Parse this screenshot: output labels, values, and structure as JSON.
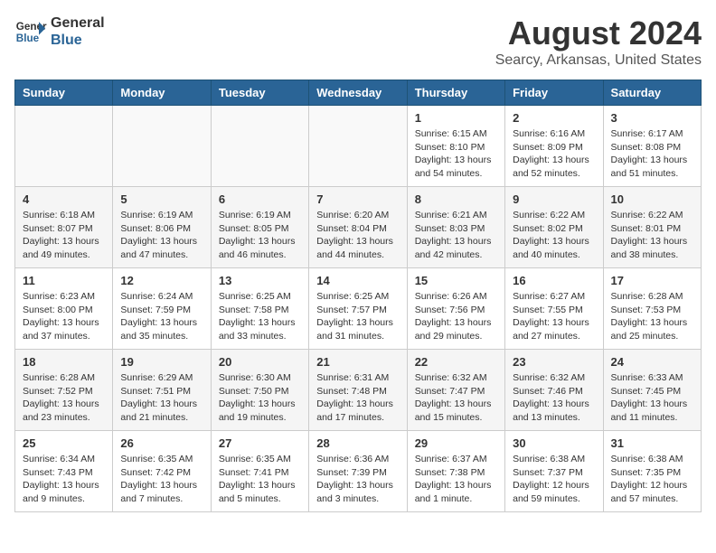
{
  "header": {
    "logo_line1": "General",
    "logo_line2": "Blue",
    "title": "August 2024",
    "subtitle": "Searcy, Arkansas, United States"
  },
  "weekdays": [
    "Sunday",
    "Monday",
    "Tuesday",
    "Wednesday",
    "Thursday",
    "Friday",
    "Saturday"
  ],
  "weeks": [
    [
      {
        "day": "",
        "info": ""
      },
      {
        "day": "",
        "info": ""
      },
      {
        "day": "",
        "info": ""
      },
      {
        "day": "",
        "info": ""
      },
      {
        "day": "1",
        "info": "Sunrise: 6:15 AM\nSunset: 8:10 PM\nDaylight: 13 hours\nand 54 minutes."
      },
      {
        "day": "2",
        "info": "Sunrise: 6:16 AM\nSunset: 8:09 PM\nDaylight: 13 hours\nand 52 minutes."
      },
      {
        "day": "3",
        "info": "Sunrise: 6:17 AM\nSunset: 8:08 PM\nDaylight: 13 hours\nand 51 minutes."
      }
    ],
    [
      {
        "day": "4",
        "info": "Sunrise: 6:18 AM\nSunset: 8:07 PM\nDaylight: 13 hours\nand 49 minutes."
      },
      {
        "day": "5",
        "info": "Sunrise: 6:19 AM\nSunset: 8:06 PM\nDaylight: 13 hours\nand 47 minutes."
      },
      {
        "day": "6",
        "info": "Sunrise: 6:19 AM\nSunset: 8:05 PM\nDaylight: 13 hours\nand 46 minutes."
      },
      {
        "day": "7",
        "info": "Sunrise: 6:20 AM\nSunset: 8:04 PM\nDaylight: 13 hours\nand 44 minutes."
      },
      {
        "day": "8",
        "info": "Sunrise: 6:21 AM\nSunset: 8:03 PM\nDaylight: 13 hours\nand 42 minutes."
      },
      {
        "day": "9",
        "info": "Sunrise: 6:22 AM\nSunset: 8:02 PM\nDaylight: 13 hours\nand 40 minutes."
      },
      {
        "day": "10",
        "info": "Sunrise: 6:22 AM\nSunset: 8:01 PM\nDaylight: 13 hours\nand 38 minutes."
      }
    ],
    [
      {
        "day": "11",
        "info": "Sunrise: 6:23 AM\nSunset: 8:00 PM\nDaylight: 13 hours\nand 37 minutes."
      },
      {
        "day": "12",
        "info": "Sunrise: 6:24 AM\nSunset: 7:59 PM\nDaylight: 13 hours\nand 35 minutes."
      },
      {
        "day": "13",
        "info": "Sunrise: 6:25 AM\nSunset: 7:58 PM\nDaylight: 13 hours\nand 33 minutes."
      },
      {
        "day": "14",
        "info": "Sunrise: 6:25 AM\nSunset: 7:57 PM\nDaylight: 13 hours\nand 31 minutes."
      },
      {
        "day": "15",
        "info": "Sunrise: 6:26 AM\nSunset: 7:56 PM\nDaylight: 13 hours\nand 29 minutes."
      },
      {
        "day": "16",
        "info": "Sunrise: 6:27 AM\nSunset: 7:55 PM\nDaylight: 13 hours\nand 27 minutes."
      },
      {
        "day": "17",
        "info": "Sunrise: 6:28 AM\nSunset: 7:53 PM\nDaylight: 13 hours\nand 25 minutes."
      }
    ],
    [
      {
        "day": "18",
        "info": "Sunrise: 6:28 AM\nSunset: 7:52 PM\nDaylight: 13 hours\nand 23 minutes."
      },
      {
        "day": "19",
        "info": "Sunrise: 6:29 AM\nSunset: 7:51 PM\nDaylight: 13 hours\nand 21 minutes."
      },
      {
        "day": "20",
        "info": "Sunrise: 6:30 AM\nSunset: 7:50 PM\nDaylight: 13 hours\nand 19 minutes."
      },
      {
        "day": "21",
        "info": "Sunrise: 6:31 AM\nSunset: 7:48 PM\nDaylight: 13 hours\nand 17 minutes."
      },
      {
        "day": "22",
        "info": "Sunrise: 6:32 AM\nSunset: 7:47 PM\nDaylight: 13 hours\nand 15 minutes."
      },
      {
        "day": "23",
        "info": "Sunrise: 6:32 AM\nSunset: 7:46 PM\nDaylight: 13 hours\nand 13 minutes."
      },
      {
        "day": "24",
        "info": "Sunrise: 6:33 AM\nSunset: 7:45 PM\nDaylight: 13 hours\nand 11 minutes."
      }
    ],
    [
      {
        "day": "25",
        "info": "Sunrise: 6:34 AM\nSunset: 7:43 PM\nDaylight: 13 hours\nand 9 minutes."
      },
      {
        "day": "26",
        "info": "Sunrise: 6:35 AM\nSunset: 7:42 PM\nDaylight: 13 hours\nand 7 minutes."
      },
      {
        "day": "27",
        "info": "Sunrise: 6:35 AM\nSunset: 7:41 PM\nDaylight: 13 hours\nand 5 minutes."
      },
      {
        "day": "28",
        "info": "Sunrise: 6:36 AM\nSunset: 7:39 PM\nDaylight: 13 hours\nand 3 minutes."
      },
      {
        "day": "29",
        "info": "Sunrise: 6:37 AM\nSunset: 7:38 PM\nDaylight: 13 hours\nand 1 minute."
      },
      {
        "day": "30",
        "info": "Sunrise: 6:38 AM\nSunset: 7:37 PM\nDaylight: 12 hours\nand 59 minutes."
      },
      {
        "day": "31",
        "info": "Sunrise: 6:38 AM\nSunset: 7:35 PM\nDaylight: 12 hours\nand 57 minutes."
      }
    ]
  ]
}
